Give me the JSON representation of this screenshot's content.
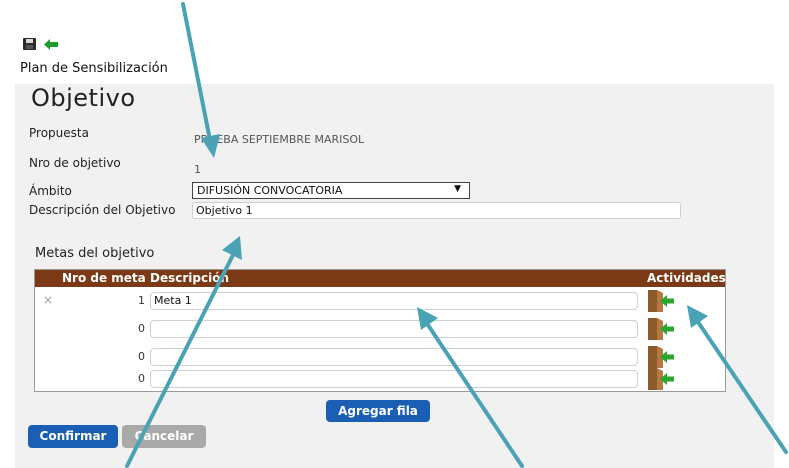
{
  "toolbar": {
    "save_icon": "save-icon",
    "back_icon": "back-icon"
  },
  "app_title": "Plan de Sensibilización",
  "page_heading": "Objetivo",
  "form": {
    "propuesta_label": "Propuesta",
    "propuesta_value": "PRUEBA SEPTIEMBRE MARISOL",
    "nro_objetivo_label": "Nro de objetivo",
    "nro_objetivo_value": "1",
    "ambito_label": "Ámbito",
    "ambito_value": "DIFUSIÓN CONVOCATORIA",
    "descripcion_label": "Descripción del Objetivo",
    "descripcion_value": "Objetivo 1"
  },
  "metas": {
    "heading": "Metas del objetivo",
    "columns": [
      "Nro de meta",
      "Descripción",
      "Actividades"
    ],
    "rows": [
      {
        "delete": "×",
        "nro": "1",
        "descripcion": "Meta 1"
      },
      {
        "delete": "",
        "nro": "0",
        "descripcion": ""
      },
      {
        "delete": "",
        "nro": "0",
        "descripcion": ""
      },
      {
        "delete": "",
        "nro": "0",
        "descripcion": ""
      }
    ],
    "add_row_label": "Agregar fila"
  },
  "actions": {
    "confirm_label": "Confirmar",
    "cancel_label": "Cancelar"
  },
  "colors": {
    "primary": "#1a5fb4",
    "grid_header": "#7b3a15",
    "annotation_arrow": "#4aa3b5",
    "disabled": "#a9a9a9"
  }
}
